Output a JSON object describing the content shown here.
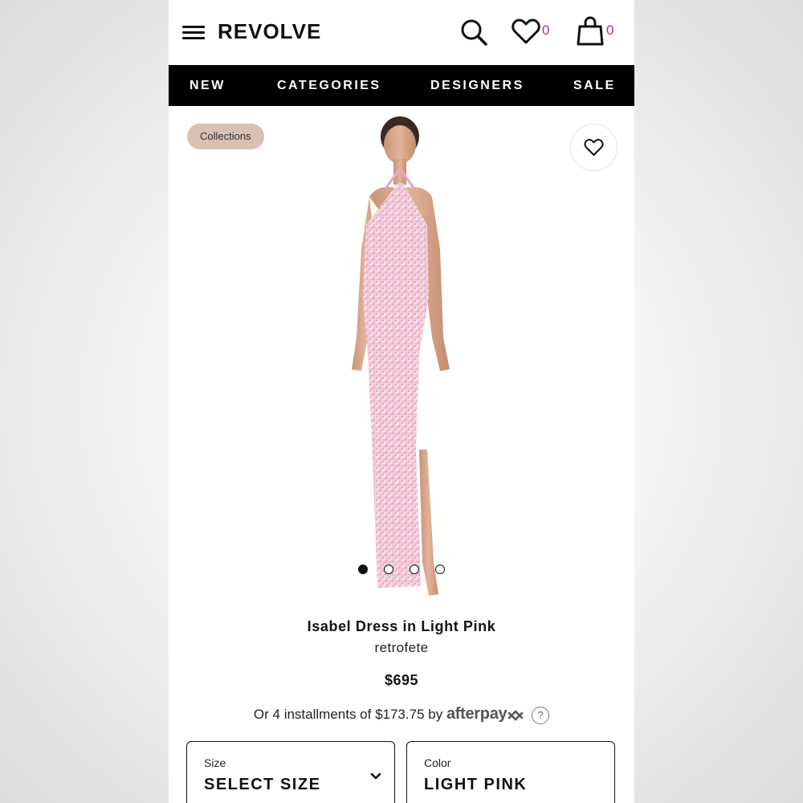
{
  "header": {
    "logo": "REVOLVE",
    "wishlist_count": "0",
    "bag_count": "0"
  },
  "nav": {
    "items": [
      "NEW",
      "CATEGORIES",
      "DESIGNERS",
      "SALE"
    ]
  },
  "gallery": {
    "tag": "Collections",
    "image_count": 4,
    "active_index": 0
  },
  "product": {
    "name": "Isabel Dress in Light Pink",
    "brand": "retrofete",
    "price": "$695",
    "installment_prefix": "Or 4 installments of $173.75 by",
    "installment_provider": "afterpay",
    "help_icon": "?"
  },
  "selectors": {
    "size": {
      "label": "Size",
      "value": "SELECT SIZE"
    },
    "color": {
      "label": "Color",
      "value": "LIGHT PINK"
    }
  },
  "colors": {
    "count_accent": "#c0248c",
    "nav_background": "#000000",
    "collections_pill": "#d8c0b2"
  },
  "icons": [
    "menu-icon",
    "search-icon",
    "heart-icon",
    "bag-icon",
    "chevron-down-icon",
    "question-icon"
  ]
}
